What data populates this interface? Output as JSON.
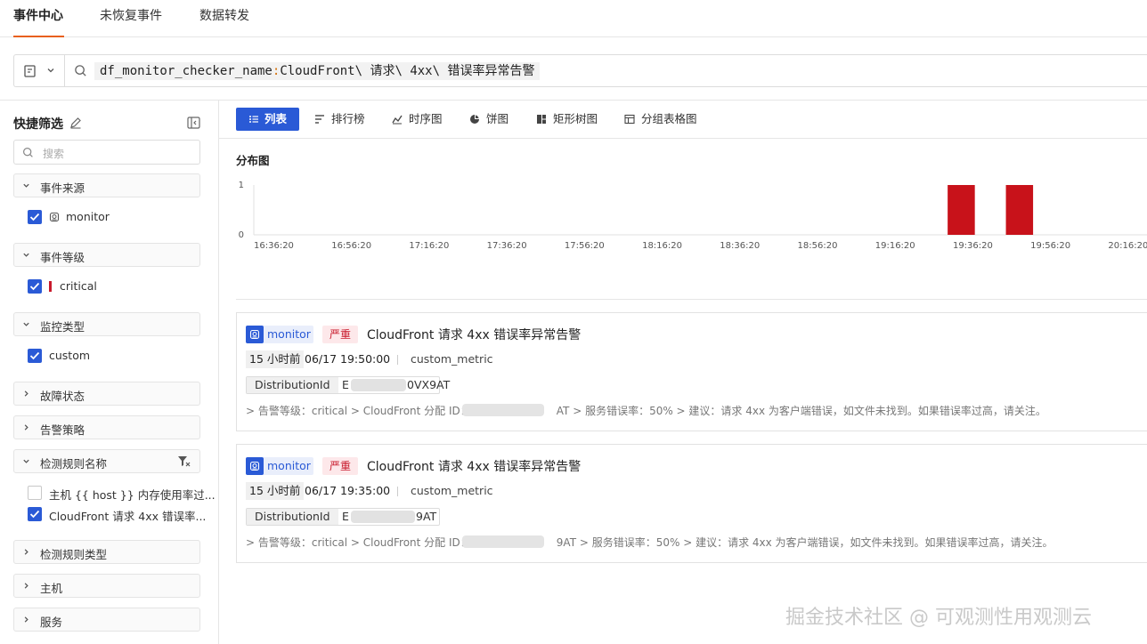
{
  "tabs": [
    {
      "label": "事件中心",
      "active": true
    },
    {
      "label": "未恢复事件",
      "active": false
    },
    {
      "label": "数据转发",
      "active": false
    }
  ],
  "search": {
    "key": "df_monitor_checker_name",
    "colon": ":",
    "value": "CloudFront\\ 请求\\ 4xx\\ 错误率异常告警"
  },
  "sidebar": {
    "title": "快捷筛选",
    "search_placeholder": "搜索",
    "groups": {
      "source": {
        "label": "事件来源",
        "options": [
          {
            "label": "monitor",
            "checked": true
          }
        ]
      },
      "level": {
        "label": "事件等级",
        "options": [
          {
            "label": "critical",
            "checked": true,
            "color": "#c8192b"
          }
        ]
      },
      "monitor_type": {
        "label": "监控类型",
        "options": [
          {
            "label": "custom",
            "checked": true
          }
        ]
      },
      "fault_status": {
        "label": "故障状态"
      },
      "alert_policy": {
        "label": "告警策略"
      },
      "rule_name": {
        "label": "检测规则名称",
        "options": [
          {
            "label": "主机 {{ host }} 内存使用率过...",
            "checked": false
          },
          {
            "label": "CloudFront 请求 4xx 错误率...",
            "checked": true
          }
        ]
      },
      "rule_type": {
        "label": "检测规则类型"
      },
      "host": {
        "label": "主机"
      },
      "service": {
        "label": "服务"
      }
    }
  },
  "views": [
    {
      "label": "列表",
      "icon": "list-icon",
      "active": true
    },
    {
      "label": "排行榜",
      "icon": "ranking-icon",
      "active": false
    },
    {
      "label": "时序图",
      "icon": "timeseries-icon",
      "active": false
    },
    {
      "label": "饼图",
      "icon": "pie-icon",
      "active": false
    },
    {
      "label": "矩形树图",
      "icon": "treemap-icon",
      "active": false
    },
    {
      "label": "分组表格图",
      "icon": "group-table-icon",
      "active": false
    }
  ],
  "distribution_title": "分布图",
  "chart_data": {
    "type": "bar",
    "title": "分布图",
    "x_ticks": [
      "16:36:20",
      "16:56:20",
      "17:16:20",
      "17:36:20",
      "17:56:20",
      "18:16:20",
      "18:36:20",
      "18:56:20",
      "19:16:20",
      "19:36:20",
      "19:56:20",
      "20:16:20"
    ],
    "x_range": [
      "16:36:20",
      "20:26:20"
    ],
    "bars": [
      {
        "start": "19:35:00",
        "end": "19:42:00",
        "value": 1
      },
      {
        "start": "19:50:00",
        "end": "19:57:00",
        "value": 1
      }
    ],
    "y_ticks": [
      0,
      1
    ],
    "ylim": [
      0,
      1
    ],
    "color": "#c8121a"
  },
  "events": [
    {
      "source": "monitor",
      "severity": "严重",
      "title": "CloudFront 请求 4xx 错误率异常告警",
      "ago": "15 小时前",
      "time": "06/17 19:50:00",
      "metric": "custom_metric",
      "tag_key": "DistributionId",
      "tag_value_prefix": "E",
      "tag_value_suffix": "0VX9AT",
      "msg_prefix": "> 告警等级：critical > CloudFront 分配 ID：",
      "msg_suffix": "AT > 服务错误率：50% > 建议：请求 4xx 为客户端错误，如文件未找到。如果错误率过高，请关注。"
    },
    {
      "source": "monitor",
      "severity": "严重",
      "title": "CloudFront 请求 4xx 错误率异常告警",
      "ago": "15 小时前",
      "time": "06/17 19:35:00",
      "metric": "custom_metric",
      "tag_key": "DistributionId",
      "tag_value_prefix": "E",
      "tag_value_suffix": "9AT",
      "msg_prefix": "> 告警等级：critical > CloudFront 分配 ID：",
      "msg_suffix": "9AT > 服务错误率：50% > 建议：请求 4xx 为客户端错误，如文件未找到。如果错误率过高，请关注。"
    }
  ],
  "watermark": "掘金技术社区 @ 可观测性用观测云",
  "colors": {
    "accent": "#2a5ad6",
    "tab_underline": "#e8601c",
    "critical": "#c8192b"
  }
}
